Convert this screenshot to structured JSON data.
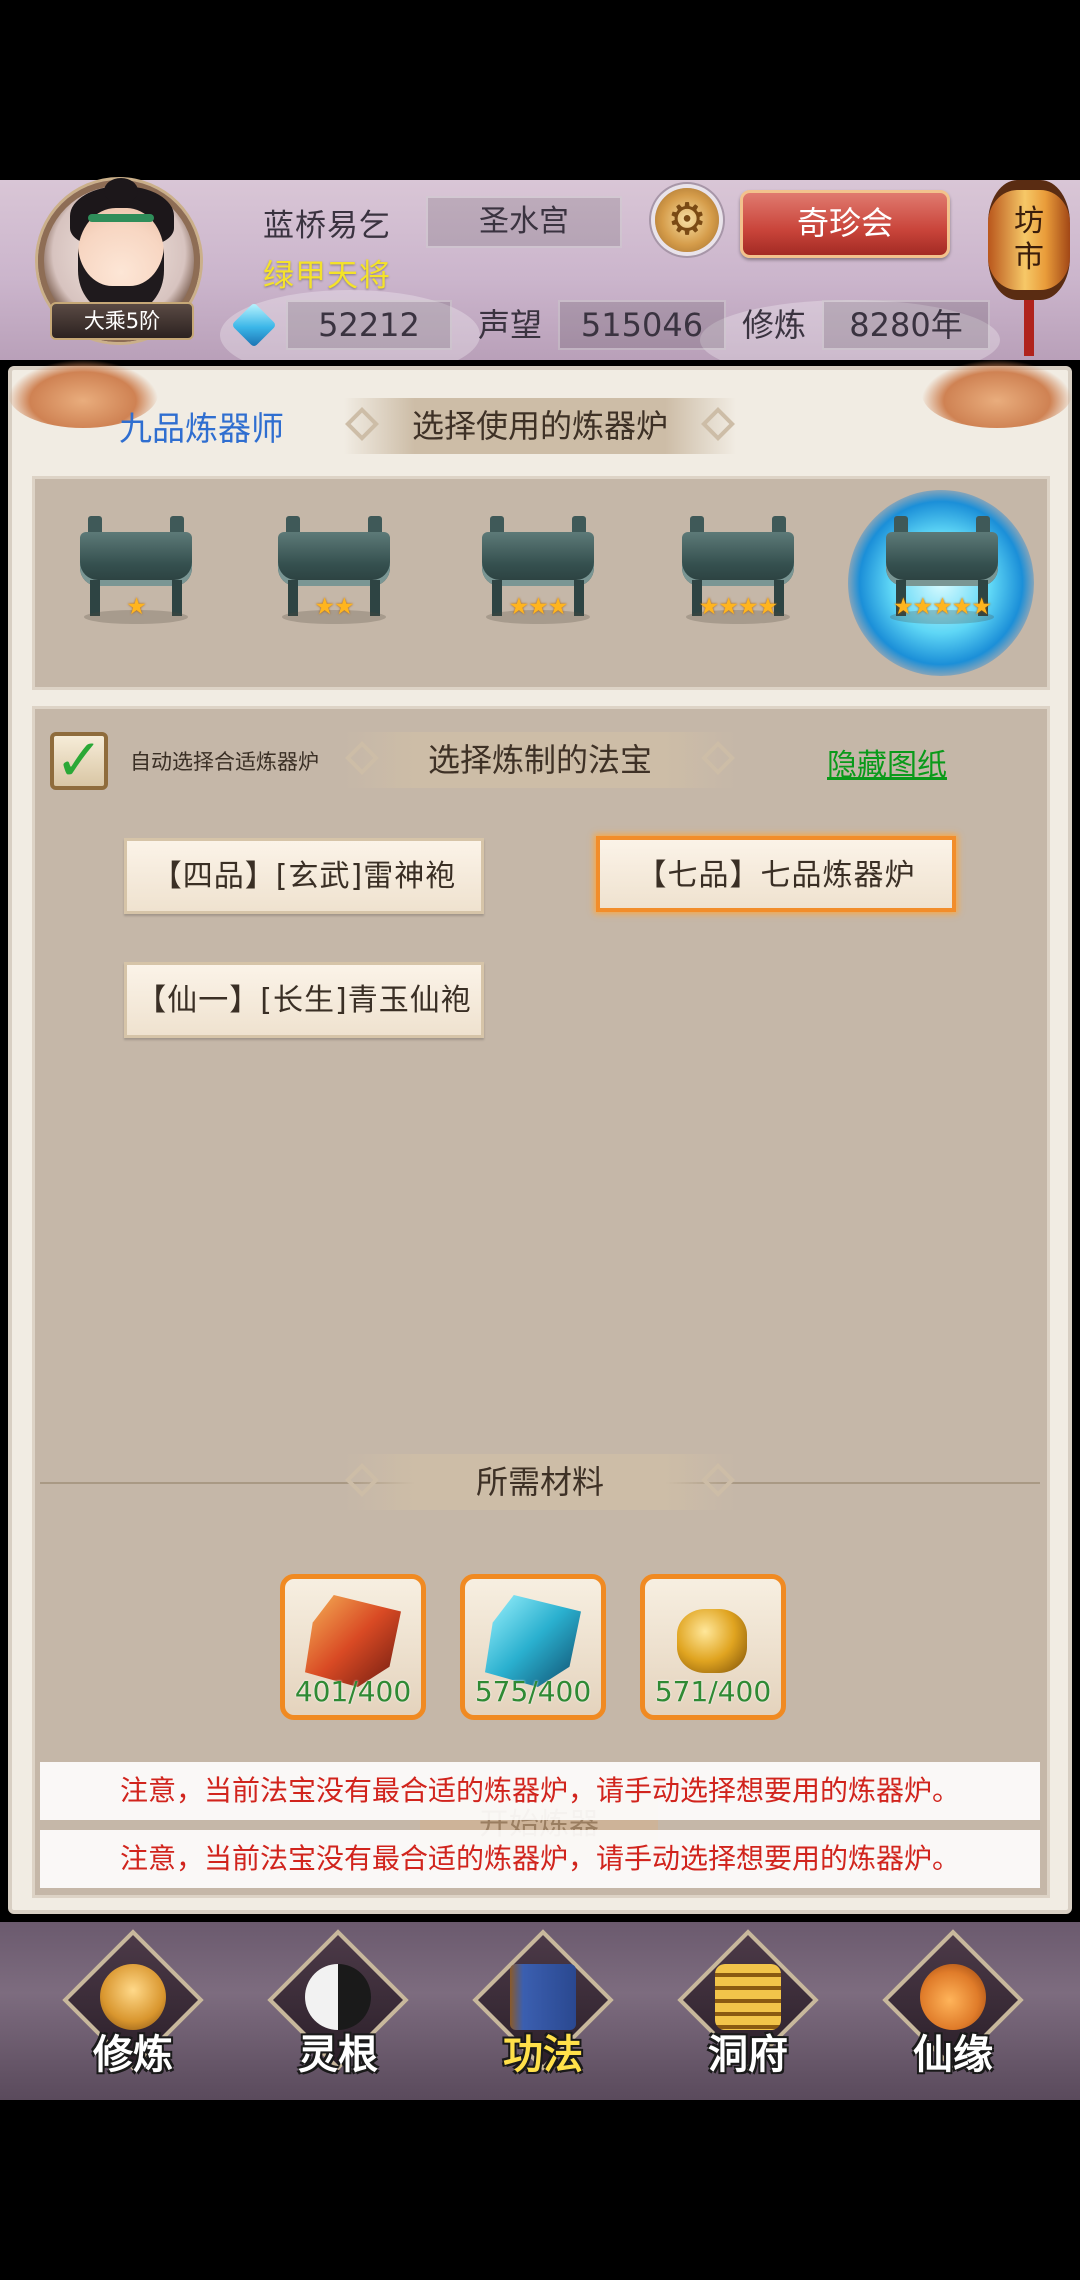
{
  "header": {
    "rank_badge": "大乘5阶",
    "player_name": "蓝桥易乞",
    "player_title": "绿甲天将",
    "sect": "圣水宫",
    "treasure_button": "奇珍会",
    "market_lantern": "坊市",
    "spirit_stones": "52212",
    "reputation_label": "声望",
    "reputation": "515046",
    "cultivation_label": "修炼",
    "cultivation_years": "8280年",
    "icons": {
      "settings": "gear-icon",
      "currency": "spirit-stone-icon"
    }
  },
  "panel": {
    "master_title": "九品炼器师",
    "furnace_section_title": "选择使用的炼器炉",
    "furnaces": [
      {
        "stars": 1,
        "stars_text": "★",
        "selected": false
      },
      {
        "stars": 2,
        "stars_text": "★★",
        "selected": false
      },
      {
        "stars": 3,
        "stars_text": "★★★",
        "selected": false
      },
      {
        "stars": 4,
        "stars_text": "★★★★",
        "selected": false
      },
      {
        "stars": 5,
        "stars_text": "★★★★★",
        "selected": true
      }
    ],
    "auto_select_label": "自动选择合适炼器炉",
    "auto_select_checked": true,
    "treasure_section_title": "选择炼制的法宝",
    "hide_blueprints_link": "隐藏图纸",
    "recipes": [
      {
        "label": "【四品】[玄武]雷神袍",
        "selected": false
      },
      {
        "label": "【七品】七品炼器炉",
        "selected": true
      },
      {
        "label": "【仙一】[长生]青玉仙袍",
        "selected": false
      }
    ],
    "materials_section_title": "所需材料",
    "materials": [
      {
        "icon": "fire-crystal-icon",
        "count": "401/400",
        "color": "#c9482a"
      },
      {
        "icon": "ice-crystal-icon",
        "count": "575/400",
        "color": "#2aa6c4"
      },
      {
        "icon": "gold-ore-icon",
        "count": "571/400",
        "color": "#e0a420"
      }
    ],
    "start_button": "开始炼器",
    "notices": [
      "注意，当前法宝没有最合适的炼器炉，请手动选择想要用的炼器炉。",
      "注意，当前法宝没有最合适的炼器炉，请手动选择想要用的炼器炉。"
    ]
  },
  "bottom_nav": {
    "items": [
      {
        "label": "修炼",
        "icon": "monk-icon",
        "active": false,
        "color": "#d9962e"
      },
      {
        "label": "灵根",
        "icon": "taiji-sword-icon",
        "active": false,
        "color": "#e8e8e8"
      },
      {
        "label": "功法",
        "icon": "scripture-book-icon",
        "active": true,
        "color": "#3b5fb0"
      },
      {
        "label": "洞府",
        "icon": "pagoda-icon",
        "active": false,
        "color": "#d9a62e"
      },
      {
        "label": "仙缘",
        "icon": "gourd-icon",
        "active": false,
        "color": "#e07c2a"
      }
    ]
  },
  "colors": {
    "accent_red": "#d1241d",
    "link_green": "#0a9a1a",
    "title_yellow": "#f4e22a",
    "selection_orange": "#f28d2a"
  }
}
